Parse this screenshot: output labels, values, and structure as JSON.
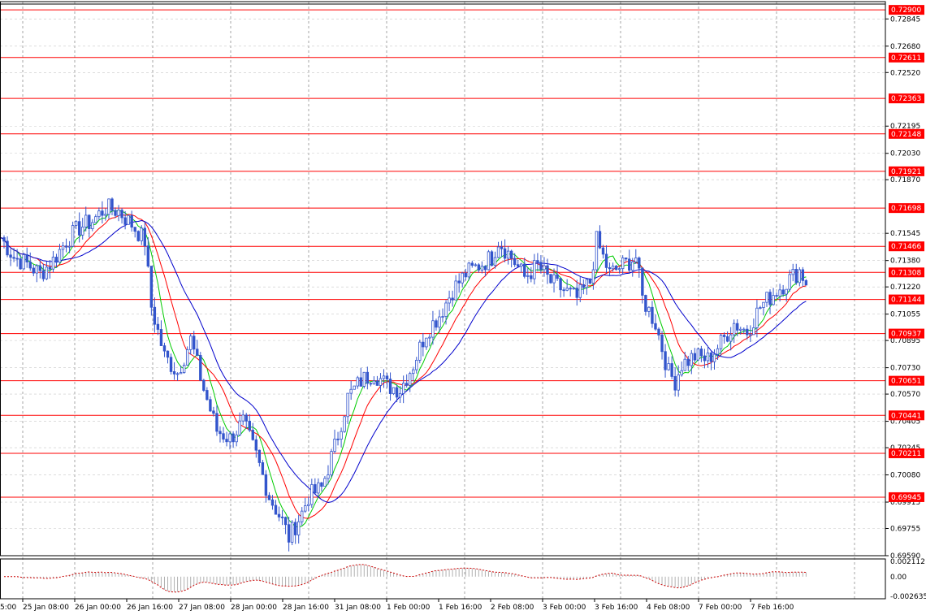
{
  "chart_data": {
    "type": "candlestick",
    "instrument_view": "price-with-moving-averages-and-levels",
    "grid": true,
    "colors": {
      "candle": "#3355cc",
      "ma_fast": "#00cc00",
      "ma_mid": "#ff0000",
      "ma_slow": "#0000cc",
      "level_line": "#ff0000",
      "level_label_bg": "#ff0000",
      "grid": "#909090",
      "osc_bars": "#b0b0b0",
      "osc_signal": "#cc0000"
    },
    "price_axis": {
      "range": [
        0.6959,
        0.7295
      ],
      "ticks": [
        "0.72845",
        "0.72680",
        "0.72520",
        "0.72195",
        "0.72030",
        "0.71870",
        "0.71545",
        "0.71380",
        "0.71220",
        "0.71055",
        "0.70895",
        "0.70730",
        "0.70570",
        "0.70405",
        "0.70245",
        "0.70080",
        "0.69915",
        "0.69755",
        "0.69590"
      ]
    },
    "levels": [
      {
        "value": 0.729,
        "label": "0.72900"
      },
      {
        "value": 0.72611,
        "label": "0.72611"
      },
      {
        "value": 0.72363,
        "label": "0.72363"
      },
      {
        "value": 0.72148,
        "label": "0.72148"
      },
      {
        "value": 0.71921,
        "label": "0.71921"
      },
      {
        "value": 0.71698,
        "label": "0.71698"
      },
      {
        "value": 0.71466,
        "label": "0.71466"
      },
      {
        "value": 0.71308,
        "label": "0.71308"
      },
      {
        "value": 0.71144,
        "label": "0.71144"
      },
      {
        "value": 0.70937,
        "label": "0.70937"
      },
      {
        "value": 0.70651,
        "label": "0.70651"
      },
      {
        "value": 0.70441,
        "label": "0.70441"
      },
      {
        "value": 0.70211,
        "label": "0.70211"
      },
      {
        "value": 0.69945,
        "label": "0.69945"
      }
    ],
    "time_axis": {
      "bars_total": 240,
      "labels": [
        {
          "bar": 0,
          "label": "25 Jan 08:00"
        },
        {
          "bar": 16,
          "label": "26 Jan 00:00"
        },
        {
          "bar": 32,
          "label": "26 Jan 16:00"
        },
        {
          "bar": 48,
          "label": "27 Jan 08:00"
        },
        {
          "bar": 64,
          "label": "28 Jan 00:00"
        },
        {
          "bar": 80,
          "label": "28 Jan 16:00"
        },
        {
          "bar": 96,
          "label": "31 Jan 08:00"
        },
        {
          "bar": 112,
          "label": "1 Feb 00:00"
        },
        {
          "bar": 128,
          "label": "1 Feb 16:00"
        },
        {
          "bar": 144,
          "label": "2 Feb 08:00"
        },
        {
          "bar": 160,
          "label": "3 Feb 00:00"
        },
        {
          "bar": 176,
          "label": "3 Feb 16:00"
        },
        {
          "bar": 192,
          "label": "4 Feb 08:00"
        },
        {
          "bar": 208,
          "label": "7 Feb 00:00"
        },
        {
          "bar": 224,
          "label": "7 Feb 16:00"
        }
      ],
      "left_edge_partial_label": "5:00"
    },
    "close_path": [
      [
        0,
        0.7152
      ],
      [
        4,
        0.714
      ],
      [
        8,
        0.7136
      ],
      [
        12,
        0.713
      ],
      [
        16,
        0.7138
      ],
      [
        20,
        0.715
      ],
      [
        24,
        0.7158
      ],
      [
        28,
        0.7162
      ],
      [
        32,
        0.717
      ],
      [
        36,
        0.7168
      ],
      [
        40,
        0.716
      ],
      [
        44,
        0.715
      ],
      [
        46,
        0.711
      ],
      [
        50,
        0.708
      ],
      [
        54,
        0.707
      ],
      [
        58,
        0.709
      ],
      [
        62,
        0.706
      ],
      [
        66,
        0.7035
      ],
      [
        70,
        0.703
      ],
      [
        74,
        0.704
      ],
      [
        78,
        0.702
      ],
      [
        82,
        0.6995
      ],
      [
        86,
        0.698
      ],
      [
        88,
        0.697
      ],
      [
        92,
        0.6985
      ],
      [
        94,
        0.6995
      ],
      [
        98,
        0.7
      ],
      [
        102,
        0.7025
      ],
      [
        106,
        0.7055
      ],
      [
        110,
        0.7065
      ],
      [
        114,
        0.707
      ],
      [
        118,
        0.7062
      ],
      [
        122,
        0.706
      ],
      [
        126,
        0.7075
      ],
      [
        130,
        0.7095
      ],
      [
        134,
        0.7105
      ],
      [
        138,
        0.712
      ],
      [
        142,
        0.713
      ],
      [
        146,
        0.7135
      ],
      [
        150,
        0.714
      ],
      [
        152,
        0.715
      ],
      [
        156,
        0.714
      ],
      [
        160,
        0.7128
      ],
      [
        164,
        0.7135
      ],
      [
        168,
        0.7125
      ],
      [
        172,
        0.712
      ],
      [
        176,
        0.7115
      ],
      [
        180,
        0.7125
      ],
      [
        182,
        0.715
      ],
      [
        186,
        0.713
      ],
      [
        190,
        0.7135
      ],
      [
        194,
        0.714
      ],
      [
        196,
        0.7115
      ],
      [
        200,
        0.71
      ],
      [
        202,
        0.7085
      ],
      [
        204,
        0.707
      ],
      [
        206,
        0.7065
      ],
      [
        208,
        0.7075
      ],
      [
        212,
        0.708
      ],
      [
        216,
        0.7078
      ],
      [
        220,
        0.7088
      ],
      [
        224,
        0.71
      ],
      [
        228,
        0.7095
      ],
      [
        232,
        0.711
      ],
      [
        236,
        0.7118
      ],
      [
        240,
        0.7125
      ],
      [
        244,
        0.7132
      ],
      [
        246,
        0.7125
      ]
    ],
    "oscillator": {
      "range": [
        -0.002635,
        0.002112
      ],
      "ticks": [
        "0.002112",
        "0.00",
        "-0.002635"
      ],
      "type": "histogram-with-signal"
    }
  }
}
